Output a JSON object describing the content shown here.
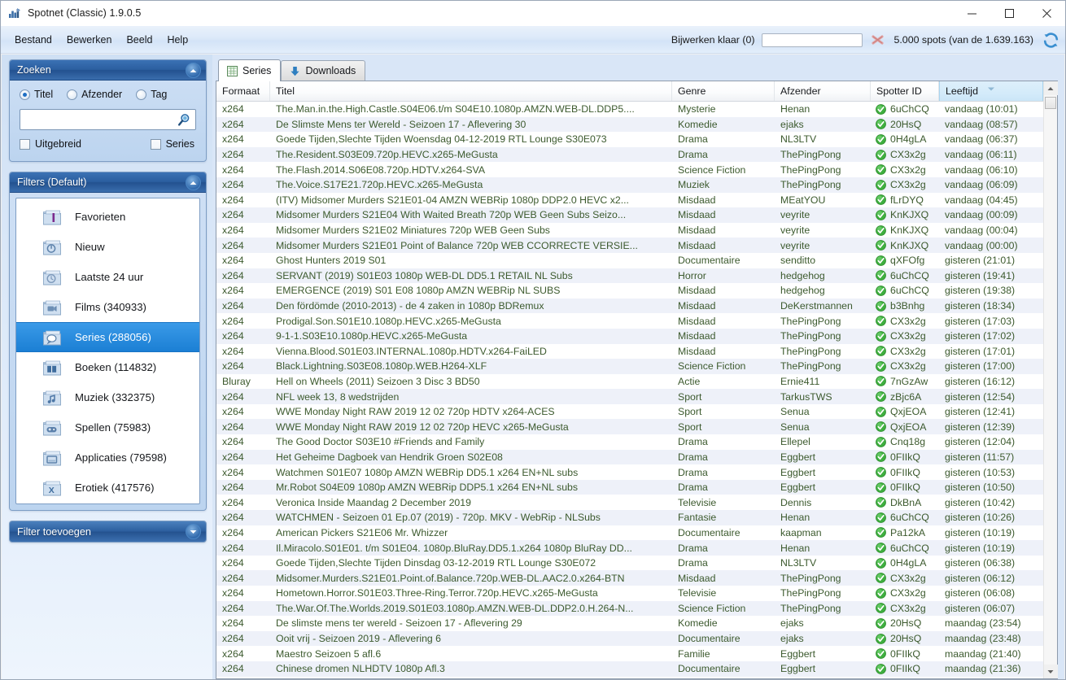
{
  "window": {
    "title": "Spotnet (Classic) 1.9.0.5",
    "icon": "app-icon",
    "minimize": "minimize",
    "maximize": "maximize",
    "close": "close"
  },
  "menu": {
    "items": [
      {
        "label": "Bestand"
      },
      {
        "label": "Bewerken"
      },
      {
        "label": "Beeld"
      },
      {
        "label": "Help"
      }
    ]
  },
  "toolbar": {
    "status": "Bijwerken klaar (0)",
    "progress_value": 0,
    "cancel_icon": "cancel-x-icon",
    "spots": "5.000 spots (van de 1.639.163)",
    "refresh_icon": "refresh-icon"
  },
  "search_panel": {
    "title": "Zoeken",
    "collapse_icon": "chevron-up-icon",
    "radios": [
      {
        "label": "Titel",
        "checked": true
      },
      {
        "label": "Afzender",
        "checked": false
      },
      {
        "label": "Tag",
        "checked": false
      }
    ],
    "input_value": "",
    "input_placeholder": "",
    "search_icon": "magnifier-icon",
    "checkboxes": [
      {
        "label": "Uitgebreid",
        "checked": false
      },
      {
        "label": "Series",
        "checked": false
      }
    ]
  },
  "filters_panel": {
    "title": "Filters (Default)",
    "collapse_icon": "chevron-up-icon",
    "items": [
      {
        "label": "Favorieten",
        "icon": "folder-favorites-icon",
        "selected": false
      },
      {
        "label": "Nieuw",
        "icon": "folder-new-icon",
        "selected": false
      },
      {
        "label": "Laatste 24 uur",
        "icon": "folder-clock-icon",
        "selected": false
      },
      {
        "label": "Films (340933)",
        "icon": "folder-film-icon",
        "selected": false
      },
      {
        "label": "Series (288056)",
        "icon": "folder-series-icon",
        "selected": true
      },
      {
        "label": "Boeken (114832)",
        "icon": "folder-books-icon",
        "selected": false
      },
      {
        "label": "Muziek (332375)",
        "icon": "folder-music-icon",
        "selected": false
      },
      {
        "label": "Spellen (75983)",
        "icon": "folder-games-icon",
        "selected": false
      },
      {
        "label": "Applicaties (79598)",
        "icon": "folder-apps-icon",
        "selected": false
      },
      {
        "label": "Erotiek (417576)",
        "icon": "folder-erotica-icon",
        "selected": false
      }
    ]
  },
  "add_filter": {
    "label": "Filter toevoegen",
    "expand_icon": "chevron-down-icon"
  },
  "tabs": [
    {
      "label": "Series",
      "icon": "grid-icon",
      "active": true
    },
    {
      "label": "Downloads",
      "icon": "download-arrow-icon",
      "active": false
    }
  ],
  "grid": {
    "columns": [
      {
        "key": "format",
        "label": "Formaat",
        "sorted": false
      },
      {
        "key": "title",
        "label": "Titel",
        "sorted": false
      },
      {
        "key": "genre",
        "label": "Genre",
        "sorted": false
      },
      {
        "key": "sender",
        "label": "Afzender",
        "sorted": false
      },
      {
        "key": "spotter",
        "label": "Spotter ID",
        "sorted": false
      },
      {
        "key": "age",
        "label": "Leeftijd",
        "sorted": true,
        "sort_dir": "desc"
      }
    ],
    "rows": [
      {
        "format": "x264",
        "title": "The.Man.in.the.High.Castle.S04E06.t/m S04E10.1080p.AMZN.WEB-DL.DDP5....",
        "genre": "Mysterie",
        "sender": "Henan",
        "spotter": "6uChCQ",
        "age": "vandaag (10:01)"
      },
      {
        "format": "x264",
        "title": "De Slimste Mens ter Wereld - Seizoen 17 - Aflevering 30",
        "genre": "Komedie",
        "sender": "ejaks",
        "spotter": "20HsQ",
        "age": "vandaag (08:57)"
      },
      {
        "format": "x264",
        "title": "Goede Tijden,Slechte Tijden Woensdag 04-12-2019 RTL Lounge S30E073",
        "genre": "Drama",
        "sender": "NL3LTV",
        "spotter": "0H4gLA",
        "age": "vandaag (06:37)"
      },
      {
        "format": "x264",
        "title": "The.Resident.S03E09.720p.HEVC.x265-MeGusta",
        "genre": "Drama",
        "sender": "ThePingPong",
        "spotter": "CX3x2g",
        "age": "vandaag (06:11)"
      },
      {
        "format": "x264",
        "title": "The.Flash.2014.S06E08.720p.HDTV.x264-SVA",
        "genre": "Science Fiction",
        "sender": "ThePingPong",
        "spotter": "CX3x2g",
        "age": "vandaag (06:10)"
      },
      {
        "format": "x264",
        "title": "The.Voice.S17E21.720p.HEVC.x265-MeGusta",
        "genre": "Muziek",
        "sender": "ThePingPong",
        "spotter": "CX3x2g",
        "age": "vandaag (06:09)"
      },
      {
        "format": "x264",
        "title": "(ITV) Midsomer Murders S21E01-04 AMZN WEBRip 1080p DDP2.0 HEVC x2...",
        "genre": "Misdaad",
        "sender": "MEatYOU",
        "spotter": "fLrDYQ",
        "age": "vandaag (04:45)"
      },
      {
        "format": "x264",
        "title": "Midsomer Murders S21E04 With Waited Breath 720p WEB Geen Subs Seizo...",
        "genre": "Misdaad",
        "sender": "veyrite",
        "spotter": "KnKJXQ",
        "age": "vandaag (00:09)"
      },
      {
        "format": "x264",
        "title": "Midsomer Murders S21E02 Miniatures 720p WEB Geen Subs",
        "genre": "Misdaad",
        "sender": "veyrite",
        "spotter": "KnKJXQ",
        "age": "vandaag (00:04)"
      },
      {
        "format": "x264",
        "title": "Midsomer Murders S21E01 Point of Balance 720p WEB CCORRECTE VERSIE...",
        "genre": "Misdaad",
        "sender": "veyrite",
        "spotter": "KnKJXQ",
        "age": "vandaag (00:00)"
      },
      {
        "format": "x264",
        "title": "Ghost Hunters 2019 S01",
        "genre": "Documentaire",
        "sender": "senditto",
        "spotter": "qXFOfg",
        "age": "gisteren (21:01)"
      },
      {
        "format": "x264",
        "title": "SERVANT (2019) S01E03 1080p WEB-DL DD5.1 RETAIL NL Subs",
        "genre": "Horror",
        "sender": "hedgehog",
        "spotter": "6uChCQ",
        "age": "gisteren (19:41)"
      },
      {
        "format": "x264",
        "title": "EMERGENCE (2019) S01 E08 1080p AMZN WEBRip NL SUBS",
        "genre": "Misdaad",
        "sender": "hedgehog",
        "spotter": "6uChCQ",
        "age": "gisteren (19:38)"
      },
      {
        "format": "x264",
        "title": "Den fördömde (2010-2013) - de 4 zaken in 1080p BDRemux",
        "genre": "Misdaad",
        "sender": "DeKerstmannen",
        "spotter": "b3Bnhg",
        "age": "gisteren (18:34)"
      },
      {
        "format": "x264",
        "title": "Prodigal.Son.S01E10.1080p.HEVC.x265-MeGusta",
        "genre": "Misdaad",
        "sender": "ThePingPong",
        "spotter": "CX3x2g",
        "age": "gisteren (17:03)"
      },
      {
        "format": "x264",
        "title": "9-1-1.S03E10.1080p.HEVC.x265-MeGusta",
        "genre": "Misdaad",
        "sender": "ThePingPong",
        "spotter": "CX3x2g",
        "age": "gisteren (17:02)"
      },
      {
        "format": "x264",
        "title": "Vienna.Blood.S01E03.INTERNAL.1080p.HDTV.x264-FaiLED",
        "genre": "Misdaad",
        "sender": "ThePingPong",
        "spotter": "CX3x2g",
        "age": "gisteren (17:01)"
      },
      {
        "format": "x264",
        "title": "Black.Lightning.S03E08.1080p.WEB.H264-XLF",
        "genre": "Science Fiction",
        "sender": "ThePingPong",
        "spotter": "CX3x2g",
        "age": "gisteren (17:00)"
      },
      {
        "format": "Bluray",
        "title": "Hell on Wheels (2011) Seizoen 3 Disc 3 BD50",
        "genre": "Actie",
        "sender": "Ernie411",
        "spotter": "7nGzAw",
        "age": "gisteren (16:12)"
      },
      {
        "format": "x264",
        "title": "NFL week 13, 8 wedstrijden",
        "genre": "Sport",
        "sender": "TarkusTWS",
        "spotter": "zBjc6A",
        "age": "gisteren (12:54)"
      },
      {
        "format": "x264",
        "title": "WWE Monday Night RAW 2019 12 02 720p HDTV x264-ACES",
        "genre": "Sport",
        "sender": "Senua",
        "spotter": "QxjEOA",
        "age": "gisteren (12:41)"
      },
      {
        "format": "x264",
        "title": "WWE Monday Night RAW 2019 12 02 720p HEVC x265-MeGusta",
        "genre": "Sport",
        "sender": "Senua",
        "spotter": "QxjEOA",
        "age": "gisteren (12:39)"
      },
      {
        "format": "x264",
        "title": "The Good Doctor S03E10 #Friends and Family",
        "genre": "Drama",
        "sender": "Ellepel",
        "spotter": "Cnq18g",
        "age": "gisteren (12:04)"
      },
      {
        "format": "x264",
        "title": "Het Geheime Dagboek van Hendrik Groen S02E08",
        "genre": "Drama",
        "sender": "Eggbert",
        "spotter": "0FIIkQ",
        "age": "gisteren (11:57)"
      },
      {
        "format": "x264",
        "title": "Watchmen S01E07 1080p AMZN WEBRip DD5.1 x264 EN+NL subs",
        "genre": "Drama",
        "sender": "Eggbert",
        "spotter": "0FIIkQ",
        "age": "gisteren (10:53)"
      },
      {
        "format": "x264",
        "title": "Mr.Robot S04E09 1080p AMZN WEBRip DDP5.1 x264 EN+NL subs",
        "genre": "Drama",
        "sender": "Eggbert",
        "spotter": "0FIIkQ",
        "age": "gisteren (10:50)"
      },
      {
        "format": "x264",
        "title": "Veronica Inside Maandag 2 December 2019",
        "genre": "Televisie",
        "sender": "Dennis",
        "spotter": "DkBnA",
        "age": "gisteren (10:42)"
      },
      {
        "format": "x264",
        "title": "WATCHMEN - Seizoen 01 Ep.07 (2019) - 720p. MKV - WebRip - NLSubs",
        "genre": "Fantasie",
        "sender": "Henan",
        "spotter": "6uChCQ",
        "age": "gisteren (10:26)"
      },
      {
        "format": "x264",
        "title": "American Pickers S21E06 Mr. Whizzer",
        "genre": "Documentaire",
        "sender": "kaapman",
        "spotter": "Pa12kA",
        "age": "gisteren (10:19)"
      },
      {
        "format": "x264",
        "title": "Il.Miracolo.S01E01. t/m S01E04. 1080p.BluRay.DD5.1.x264 1080p BluRay DD...",
        "genre": "Drama",
        "sender": "Henan",
        "spotter": "6uChCQ",
        "age": "gisteren (10:19)"
      },
      {
        "format": "x264",
        "title": "Goede Tijden,Slechte Tijden Dinsdag 03-12-2019 RTL Lounge S30E072",
        "genre": "Drama",
        "sender": "NL3LTV",
        "spotter": "0H4gLA",
        "age": "gisteren (06:38)"
      },
      {
        "format": "x264",
        "title": "Midsomer.Murders.S21E01.Point.of.Balance.720p.WEB-DL.AAC2.0.x264-BTN",
        "genre": "Misdaad",
        "sender": "ThePingPong",
        "spotter": "CX3x2g",
        "age": "gisteren (06:12)"
      },
      {
        "format": "x264",
        "title": "Hometown.Horror.S01E03.Three-Ring.Terror.720p.HEVC.x265-MeGusta",
        "genre": "Televisie",
        "sender": "ThePingPong",
        "spotter": "CX3x2g",
        "age": "gisteren (06:08)"
      },
      {
        "format": "x264",
        "title": "The.War.Of.The.Worlds.2019.S01E03.1080p.AMZN.WEB-DL.DDP2.0.H.264-N...",
        "genre": "Science Fiction",
        "sender": "ThePingPong",
        "spotter": "CX3x2g",
        "age": "gisteren (06:07)"
      },
      {
        "format": "x264",
        "title": "De slimste mens ter wereld - Seizoen 17 - Aflevering 29",
        "genre": "Komedie",
        "sender": "ejaks",
        "spotter": "20HsQ",
        "age": "maandag (23:54)"
      },
      {
        "format": "x264",
        "title": "Ooit vrij - Seizoen 2019 - Aflevering 6",
        "genre": "Documentaire",
        "sender": "ejaks",
        "spotter": "20HsQ",
        "age": "maandag (23:48)"
      },
      {
        "format": "x264",
        "title": "Maestro Seizoen 5 afl.6",
        "genre": "Familie",
        "sender": "Eggbert",
        "spotter": "0FIIkQ",
        "age": "maandag (21:40)"
      },
      {
        "format": "x264",
        "title": "Chinese dromen NLHDTV 1080p Afl.3",
        "genre": "Documentaire",
        "sender": "Eggbert",
        "spotter": "0FIIkQ",
        "age": "maandag (21:36)"
      }
    ],
    "scrollbar": {
      "up_icon": "scroll-up-icon",
      "down_icon": "scroll-down-icon"
    }
  },
  "colors": {
    "accent": "#1b7fd4",
    "panel_header": "#2b5e9f",
    "row_text": "#3c5a2e",
    "alt_row": "#eef1f9",
    "stamp_green": "#3aa93a"
  }
}
